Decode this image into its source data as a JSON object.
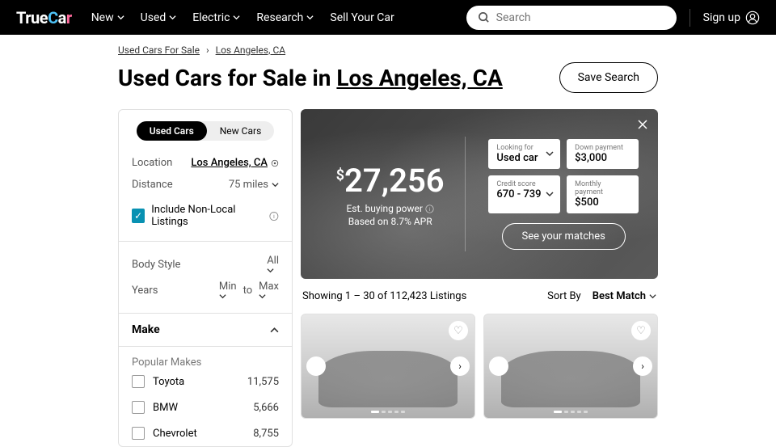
{
  "nav": {
    "items": [
      "New",
      "Used",
      "Electric",
      "Research"
    ],
    "sell": "Sell Your Car"
  },
  "search": {
    "placeholder": "Search"
  },
  "signup": "Sign up",
  "crumbs": {
    "a": "Used Cars For Sale",
    "b": "Los Angeles, CA"
  },
  "title": {
    "pre": "Used Cars for Sale in ",
    "loc": "Los Angeles, CA"
  },
  "save": "Save Search",
  "tabs": {
    "used": "Used Cars",
    "new": "New Cars"
  },
  "filters": {
    "location_label": "Location",
    "location_val": "Los Angeles, CA",
    "distance_label": "Distance",
    "distance_val": "75 miles",
    "nonlocal": "Include Non-Local Listings",
    "body_label": "Body Style",
    "body_val": "All",
    "years_label": "Years",
    "years_min": "Min",
    "years_to": "to",
    "years_max": "Max",
    "make": "Make",
    "popular": "Popular Makes",
    "makes": [
      {
        "name": "Toyota",
        "count": "11,575"
      },
      {
        "name": "BMW",
        "count": "5,666"
      },
      {
        "name": "Chevrolet",
        "count": "8,755"
      }
    ]
  },
  "hero": {
    "price": "27,256",
    "est": "Est. buying power",
    "apr": "Based on 8.7% APR",
    "looking_lbl": "Looking for",
    "looking_val": "Used car",
    "down_lbl": "Down payment",
    "down_val": "$3,000",
    "credit_lbl": "Credit score",
    "credit_val": "670 - 739",
    "monthly_lbl": "Monthly payment",
    "monthly_val": "$500",
    "cta": "See your matches"
  },
  "list": {
    "showing": "Showing 1 – 30 of 112,423 Listings",
    "sort_lbl": "Sort By",
    "sort_val": "Best Match"
  }
}
